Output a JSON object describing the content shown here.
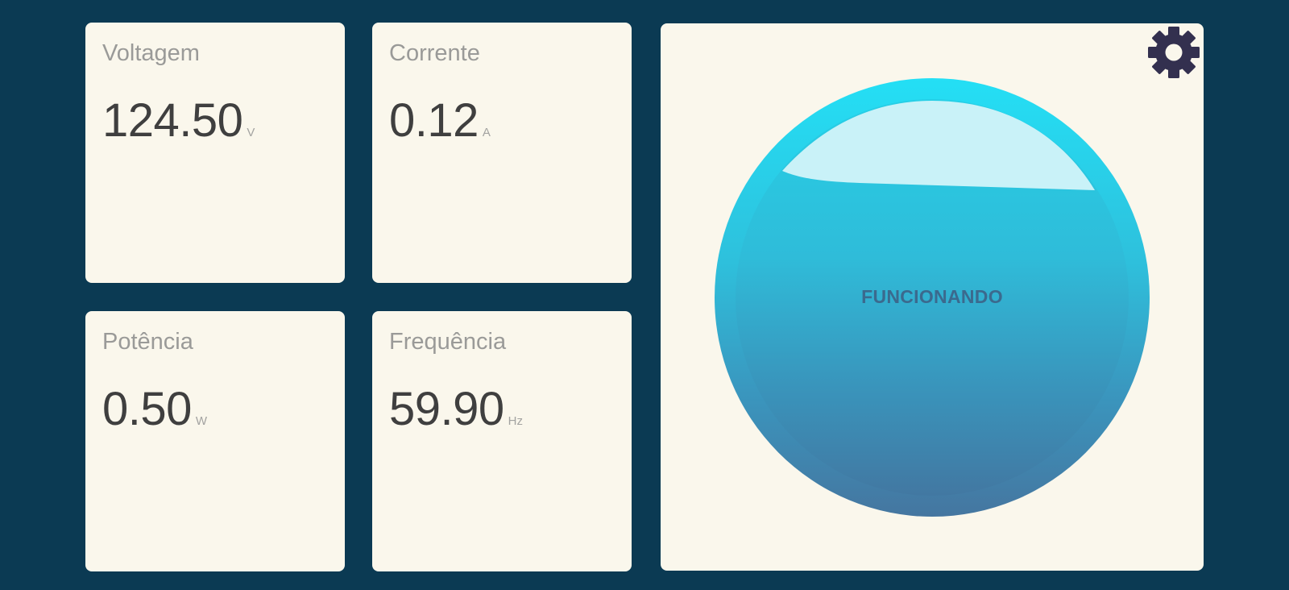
{
  "metrics": {
    "voltage": {
      "label": "Voltagem",
      "value": "124.50",
      "unit": "V"
    },
    "current": {
      "label": "Corrente",
      "value": "0.12",
      "unit": "A"
    },
    "power": {
      "label": "Potência",
      "value": "0.50",
      "unit": "W"
    },
    "frequency": {
      "label": "Frequência",
      "value": "59.90",
      "unit": "Hz"
    }
  },
  "status": {
    "text": "FUNCIONANDO",
    "settings_icon": "gear-icon"
  },
  "colors": {
    "background": "#0b3a53",
    "card": "#faf7ec",
    "label": "#9a9a98",
    "value": "#3f3f3f",
    "orb_top": "#24dff5",
    "orb_bottom": "#4576a0",
    "status_text": "#3b6a8e",
    "gear": "#33304f"
  }
}
